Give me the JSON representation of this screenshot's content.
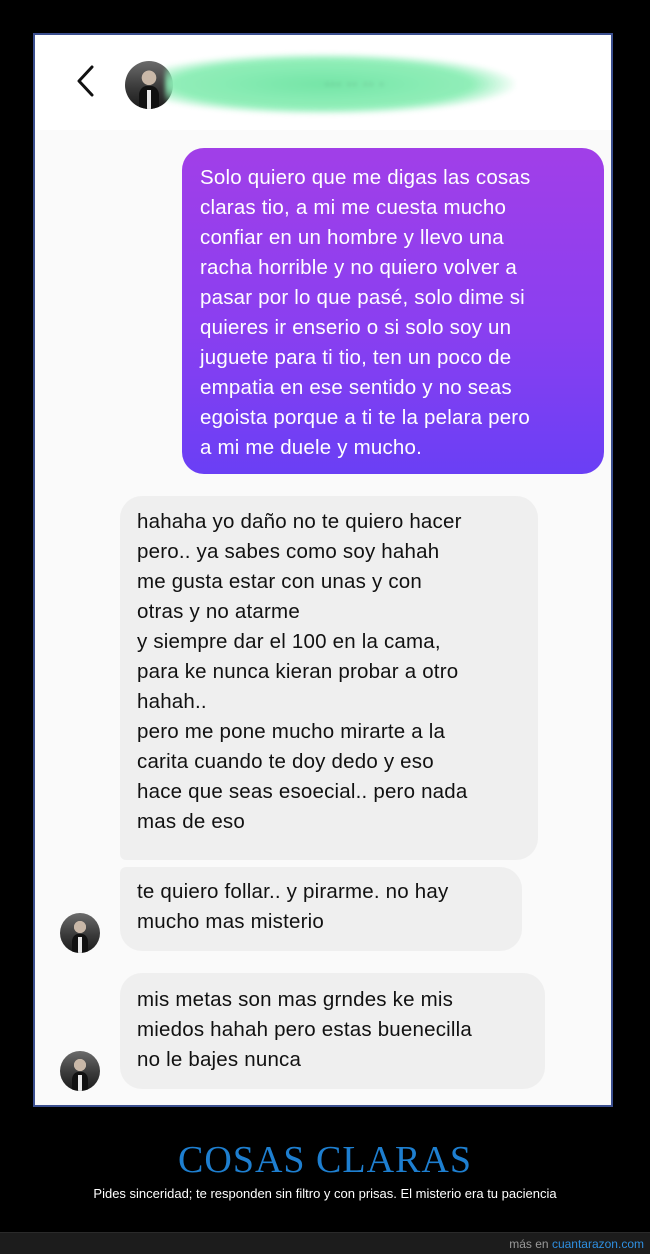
{
  "conversation": {
    "sent_message": {
      "lines": [
        "Solo quiero que me digas las cosas",
        "claras tio, a mi me cuesta mucho",
        "confiar en un hombre y llevo una",
        "racha horrible y no quiero volver a",
        "pasar por lo que pasé, solo dime si",
        "quieres ir enserio o si solo soy un",
        "juguete para ti tio, ten un poco de",
        "empatia en ese sentido y no seas",
        "egoista porque a ti te la pelara pero",
        "a mi me duele y mucho."
      ]
    },
    "received_messages": [
      {
        "lines": [
          "hahaha yo daño no te quiero hacer",
          "pero.. ya sabes como soy hahah",
          "me gusta estar con unas y con",
          "otras y no atarme",
          "y siempre dar el 100 en la cama,",
          "para ke nunca kieran probar a otro",
          "hahah..",
          "pero me pone mucho mirarte a la",
          "carita cuando te doy dedo y eso",
          "hace que seas esoecial.. pero nada",
          "mas de eso"
        ]
      },
      {
        "lines": [
          "te quiero follar.. y pirarme. no hay",
          "mucho mas misterio"
        ]
      },
      {
        "lines": [
          "mis metas son mas grndes ke mis",
          "miedos hahah pero estas buenecilla",
          "no le bajes nunca"
        ]
      }
    ]
  },
  "header": {
    "back_icon": "chevron-left-icon",
    "redacted_name_marks": "···  ·· ·· ·"
  },
  "caption": {
    "title": "COSAS CLARAS",
    "subtitle": "Pides sinceridad; te responden sin filtro y con prisas. El misterio era tu paciencia"
  },
  "footer": {
    "prefix": "más en",
    "site": "cuantarazon.com"
  },
  "colors": {
    "sent_gradient_top": "#a13fe8",
    "sent_gradient_bottom": "#6a3ff5",
    "received_bg": "#efefef",
    "title_blue": "#1e7fd0",
    "redaction_green": "#8ceeb6"
  }
}
